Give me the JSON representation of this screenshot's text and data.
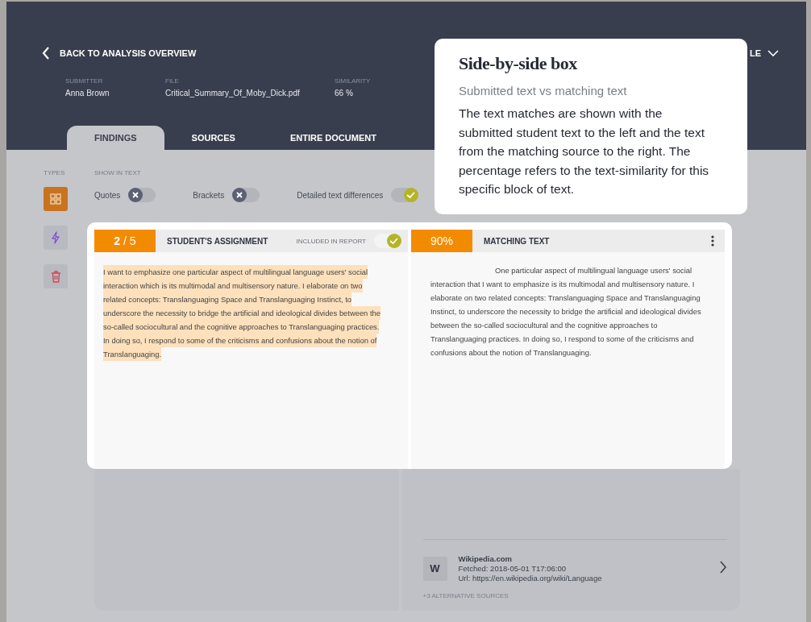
{
  "header": {
    "back_link": "BACK TO ANALYSIS OVERVIEW",
    "menu_fragment": "LE",
    "meta": [
      {
        "label": "SUBMITTER",
        "value": "Anna Brown"
      },
      {
        "label": "FILE",
        "value": "Critical_Summary_Of_Moby_Dick.pdf"
      },
      {
        "label": "SIMILARITY",
        "value": "66 %"
      }
    ]
  },
  "tabs": [
    {
      "label": "FINDINGS",
      "selected": true
    },
    {
      "label": "SOURCES",
      "selected": false
    },
    {
      "label": "ENTIRE DOCUMENT",
      "selected": false
    }
  ],
  "types": {
    "label": "TYPES",
    "items": [
      {
        "kind": "grid",
        "selected": true
      },
      {
        "kind": "lightning",
        "selected": false
      },
      {
        "kind": "trash",
        "selected": false
      }
    ]
  },
  "show_in_text": {
    "label": "SHOW IN TEXT",
    "toggles": [
      {
        "label": "Quotes",
        "on": false
      },
      {
        "label": "Brackets",
        "on": false
      },
      {
        "label": "Detailed text differences",
        "on": true
      }
    ]
  },
  "finding": {
    "counter": "**2** / 5",
    "student_heading": "STUDENT'S ASSIGNMENT",
    "included_label": "INCLUDED IN REPORT",
    "included": true,
    "student_text": "I want to emphasize one particular aspect of multilingual language users' social interaction which is its multimodal and multisensory nature. I elaborate on two related concepts: Translanguaging Space and Translanguaging Instinct, to underscore the necessity to bridge the artificial and ideological divides between the so-called sociocultural and the cognitive approaches to Translanguaging practices. In doing so, I respond to some of the criticisms and confusions about the notion of Translanguaging.",
    "percent": "90%",
    "matching_heading": "MATCHING TEXT",
    "matching_text": "One particular aspect of multilingual language users' social interaction that I want to emphasize is its multimodal and multisensory nature. I elaborate on two related concepts: Translanguaging Space and Translanguaging Instinct, to underscore the necessity to bridge the artificial and ideological divides between the so-called sociocultural and the cognitive approaches to Translanguaging practices. In doing so, I respond to some of the criticisms and confusions about the notion of Translanguaging.",
    "source": {
      "initial": "W",
      "name": "Wikipedia.com",
      "fetched": "Fetched: 2018-05-01 T17:06:00",
      "url": "Url: https://en.wikipedia.org/wiki/Language",
      "alternatives": "+3 ALTERNATIVE SOURCES"
    }
  },
  "tooltip": {
    "title": "Side-by-side box",
    "subtitle": "Submitted text vs matching text",
    "body": "The text matches are shown with the submitted student text to the left and the text from the matching source to the right. The percentage refers to the text-similarity for this specific block of text."
  }
}
